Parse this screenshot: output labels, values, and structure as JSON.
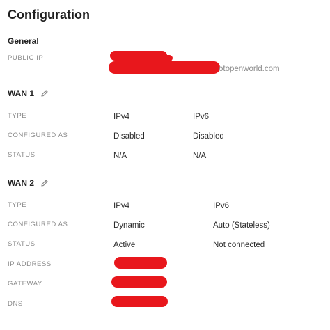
{
  "page": {
    "title": "Configuration"
  },
  "general": {
    "heading": "General",
    "public_ip_label": "PUBLIC IP",
    "public_ip_visible_suffix": "otopenworld.com"
  },
  "wan1": {
    "heading": "WAN 1",
    "edit_icon": "pencil-icon",
    "rows": {
      "type": {
        "label": "TYPE",
        "ipv4": "IPv4",
        "ipv6": "IPv6"
      },
      "configured_as": {
        "label": "CONFIGURED AS",
        "ipv4": "Disabled",
        "ipv6": "Disabled"
      },
      "status": {
        "label": "STATUS",
        "ipv4": "N/A",
        "ipv6": "N/A"
      }
    }
  },
  "wan2": {
    "heading": "WAN 2",
    "edit_icon": "pencil-icon",
    "rows": {
      "type": {
        "label": "TYPE",
        "ipv4": "IPv4",
        "ipv6": "IPv6"
      },
      "configured_as": {
        "label": "CONFIGURED AS",
        "ipv4": "Dynamic",
        "ipv6": "Auto (Stateless)"
      },
      "status": {
        "label": "STATUS",
        "ipv4": "Active",
        "ipv6": "Not connected"
      },
      "ip_address": {
        "label": "IP ADDRESS"
      },
      "gateway": {
        "label": "GATEWAY"
      },
      "dns": {
        "label": "DNS"
      }
    }
  },
  "colors": {
    "redaction": "#e8171c",
    "label": "#8a8a8a",
    "text": "#2b2b2b"
  }
}
